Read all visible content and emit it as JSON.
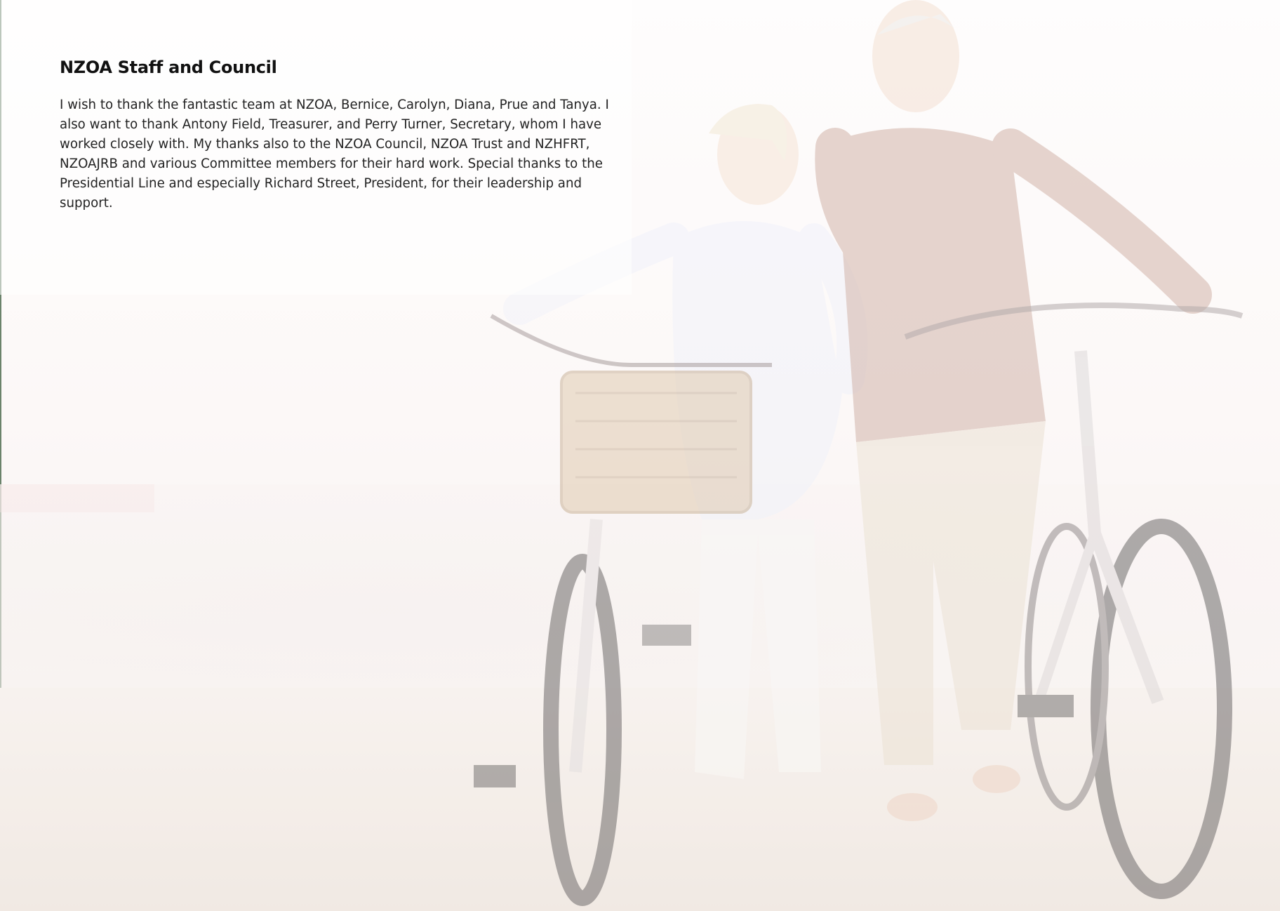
{
  "section": {
    "title": "NZOA Staff and Council",
    "paragraph": "I wish to thank the fantastic team at NZOA, Bernice, Carolyn, Diana, Prue and Tanya. I also want to thank Antony Field, Treasurer, and Perry Turner, Secretary, whom I have worked closely with. My thanks also to the NZOA Council, NZOA Trust and NZHFRT, NZOAJRB and various Committee members for their hard work. Special thanks to the Presidential Line and especially Richard Street, President, for their leadership and support."
  },
  "background": {
    "image_subject": "faded-beach-couple-with-bicycles",
    "tint_color": "#f6eeea"
  }
}
